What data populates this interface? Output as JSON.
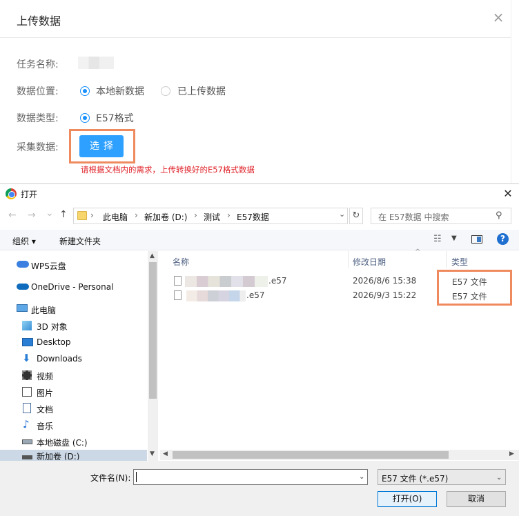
{
  "modal": {
    "title": "上传数据",
    "close_icon": "×",
    "fields": {
      "task_name_label": "任务名称:",
      "data_location_label": "数据位置:",
      "data_location_options": [
        "本地新数据",
        "已上传数据"
      ],
      "data_location_selected": "本地新数据",
      "data_type_label": "数据类型:",
      "data_type_option": "E57格式",
      "collect_label": "采集数据:",
      "select_button": "选择",
      "hint": "请根据文档内的需求，上传转换好的E57格式数据"
    },
    "colors": {
      "primary": "#2ea0ff",
      "hint": "#e0242b",
      "highlight": "#ef8a5f"
    }
  },
  "dialog": {
    "title": "打开",
    "close_icon": "✕",
    "nav": {
      "back": "←",
      "forward": "→",
      "dropdown": "⌄",
      "up": "↑"
    },
    "address": {
      "parts": [
        "此电脑",
        "新加卷 (D:)",
        "测试",
        "E57数据"
      ]
    },
    "search_placeholder": "在 E57数据 中搜索",
    "toolbar": {
      "organize": "组织 ▾",
      "new_folder": "新建文件夹",
      "help": "?"
    },
    "nav_pane": [
      {
        "label": "WPS云盘",
        "icon": "cloud-icon"
      },
      {
        "label": "OneDrive - Personal",
        "icon": "onedrive-icon"
      },
      {
        "label": "此电脑",
        "icon": "computer-icon"
      },
      {
        "label": "3D 对象",
        "icon": "cube-icon"
      },
      {
        "label": "Desktop",
        "icon": "desktop-icon"
      },
      {
        "label": "Downloads",
        "icon": "download-icon"
      },
      {
        "label": "视频",
        "icon": "video-icon"
      },
      {
        "label": "图片",
        "icon": "picture-icon"
      },
      {
        "label": "文档",
        "icon": "document-icon"
      },
      {
        "label": "音乐",
        "icon": "music-icon"
      },
      {
        "label": "本地磁盘 (C:)",
        "icon": "drive-icon"
      },
      {
        "label": "新加卷 (D:)",
        "icon": "drive-icon"
      }
    ],
    "columns": {
      "name": "名称",
      "modified": "修改日期",
      "type": "类型"
    },
    "files": [
      {
        "name_suffix": ".e57",
        "modified": "2026/8/6 15:38",
        "type": "E57 文件"
      },
      {
        "name_suffix": ".e57",
        "modified": "2026/9/3 15:22",
        "type": "E57 文件"
      }
    ],
    "filename_label": "文件名(N):",
    "filename_value": "",
    "file_type_filter": "E57 文件 (*.e57)",
    "open_button": "打开(O)",
    "cancel_button": "取消"
  }
}
